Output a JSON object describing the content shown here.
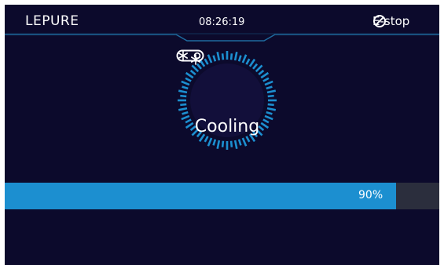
{
  "header": {
    "logo_text": "LEPURE",
    "clock": "08:26:19",
    "estop_label": "E-stop",
    "estop_icon": "prohibit-icon"
  },
  "dial": {
    "status_label": "Cooling",
    "icons": [
      "snowflake-icon",
      "toggle-icon"
    ],
    "accent_color": "#1c8fd0"
  },
  "progress": {
    "value": 0.9,
    "label": "90%"
  },
  "colors": {
    "background": "#0c0a2c",
    "accent": "#1c8fd0",
    "track": "#2b2e3d"
  }
}
